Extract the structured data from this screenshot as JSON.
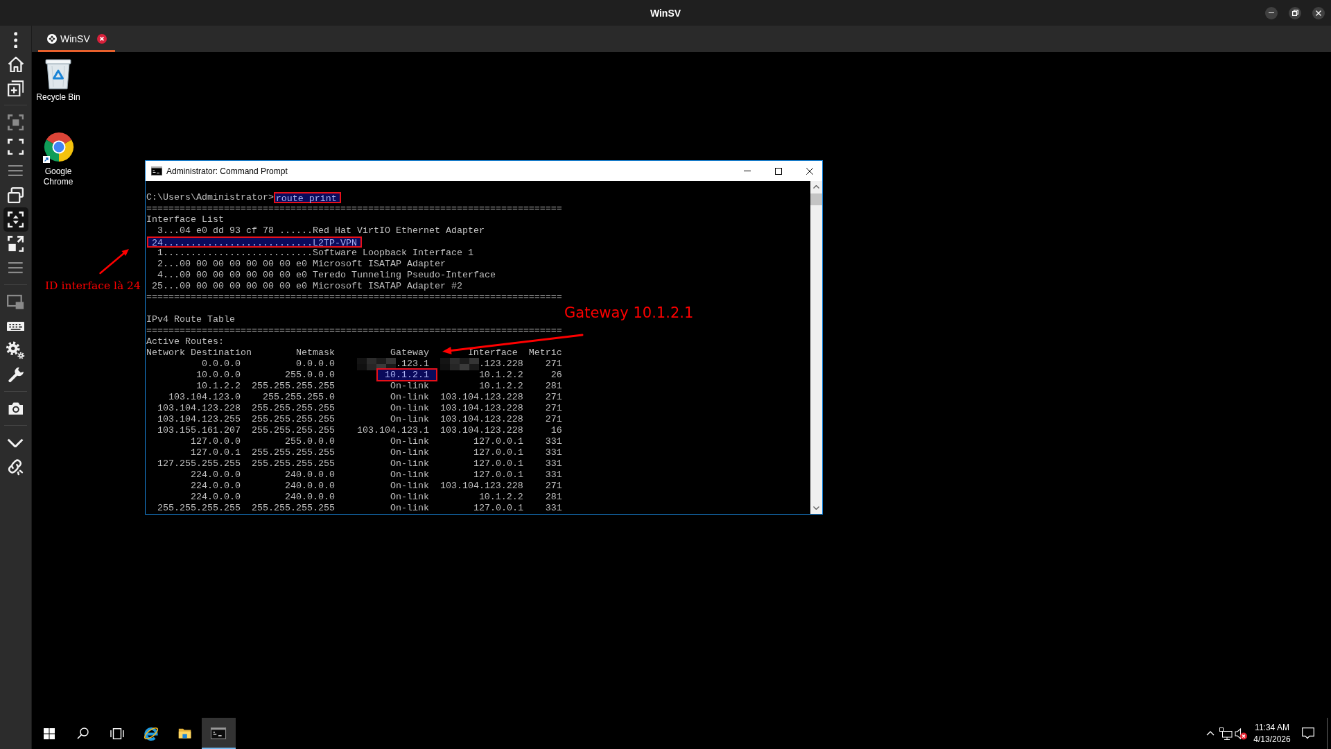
{
  "app": {
    "title": "WinSV"
  },
  "sidebar": {
    "groups": [
      {
        "items": [
          {
            "kind": "more",
            "disabled": false,
            "selected": false
          },
          {
            "kind": "home",
            "disabled": false,
            "selected": false
          },
          {
            "kind": "new_window",
            "disabled": false,
            "selected": false
          }
        ]
      },
      {
        "items": [
          {
            "kind": "focus",
            "disabled": true,
            "selected": false
          },
          {
            "kind": "fullscreen",
            "disabled": false,
            "selected": false
          },
          {
            "kind": "handle",
            "disabled": true,
            "selected": false
          },
          {
            "kind": "windows",
            "disabled": false,
            "selected": false
          },
          {
            "kind": "fit",
            "disabled": false,
            "selected": true
          },
          {
            "kind": "resize",
            "disabled": false,
            "selected": false
          },
          {
            "kind": "handle",
            "disabled": true,
            "selected": false
          }
        ]
      },
      {
        "items": [
          {
            "kind": "display",
            "disabled": true,
            "selected": false
          },
          {
            "kind": "keyboard",
            "disabled": false,
            "selected": false
          },
          {
            "kind": "settings",
            "disabled": false,
            "selected": false
          },
          {
            "kind": "tools",
            "disabled": false,
            "selected": false
          }
        ]
      },
      {
        "items": [
          {
            "kind": "screenshot",
            "disabled": false,
            "selected": false
          }
        ]
      },
      {
        "items": [
          {
            "kind": "collapse",
            "disabled": false,
            "selected": false
          },
          {
            "kind": "link",
            "disabled": false,
            "selected": false
          }
        ]
      }
    ]
  },
  "tabs": [
    {
      "label": "WinSV",
      "selected": true
    }
  ],
  "desktop": {
    "shortcuts": [
      {
        "kind": "recycle_bin",
        "label": "Recycle Bin"
      },
      {
        "kind": "browser",
        "label": "Google Chrome"
      }
    ]
  },
  "console_window": {
    "title": "Administrator: Command Prompt",
    "lines": [
      {
        "kind": "prompt",
        "prompt": "C:\\Users\\Administrator>",
        "command": "route print",
        "highlighted": true
      },
      {
        "kind": "output",
        "text": "===========================================================================",
        "highlighted": false
      },
      {
        "kind": "output",
        "text": "Interface List",
        "highlighted": false
      },
      {
        "kind": "interface",
        "text": "3...04 e0 dd 93 cf 78 ......Red Hat VirtIO Ethernet Adapter",
        "highlighted": false
      },
      {
        "kind": "interface",
        "text": "24...........................L2TP-VPN",
        "highlighted": true
      },
      {
        "kind": "interface",
        "text": "1...........................Software Loopback Interface 1",
        "highlighted": false
      },
      {
        "kind": "interface",
        "text": "2...00 00 00 00 00 00 00 e0 Microsoft ISATAP Adapter",
        "highlighted": false
      },
      {
        "kind": "interface",
        "text": "4...00 00 00 00 00 00 00 e0 Teredo Tunneling Pseudo-Interface",
        "highlighted": false
      },
      {
        "kind": "interface",
        "text": "25...00 00 00 00 00 00 00 e0 Microsoft ISATAP Adapter #2",
        "highlighted": false
      },
      {
        "kind": "output",
        "text": "===========================================================================",
        "highlighted": false
      },
      {
        "kind": "blank"
      },
      {
        "kind": "output",
        "text": "IPv4 Route Table",
        "highlighted": false
      },
      {
        "kind": "output",
        "text": "===========================================================================",
        "highlighted": false
      },
      {
        "kind": "output",
        "text": "Active Routes:",
        "highlighted": false
      },
      {
        "kind": "route_header",
        "columns": [
          "Network Destination",
          "Netmask",
          "Gateway",
          "Interface",
          "Metric"
        ]
      },
      {
        "kind": "route",
        "cells": [
          "0.0.0.0",
          "0.0.0.0",
          ".123.1",
          ".123.228",
          "271"
        ],
        "gateway_redacted": true,
        "interface_redacted": true,
        "gateway_highlighted": false
      },
      {
        "kind": "route",
        "cells": [
          "10.0.0.0",
          "255.0.0.0",
          "10.1.2.1",
          "10.1.2.2",
          "26"
        ],
        "gateway_redacted": false,
        "interface_redacted": false,
        "gateway_highlighted": true
      },
      {
        "kind": "route",
        "cells": [
          "10.1.2.2",
          "255.255.255.255",
          "On-link",
          "10.1.2.2",
          "281"
        ],
        "gateway_redacted": false,
        "interface_redacted": false,
        "gateway_highlighted": false
      },
      {
        "kind": "route",
        "cells": [
          "103.104.123.0",
          "255.255.255.0",
          "On-link",
          "103.104.123.228",
          "271"
        ],
        "gateway_redacted": false,
        "interface_redacted": false,
        "gateway_highlighted": false
      },
      {
        "kind": "route",
        "cells": [
          "103.104.123.228",
          "255.255.255.255",
          "On-link",
          "103.104.123.228",
          "271"
        ],
        "gateway_redacted": false,
        "interface_redacted": false,
        "gateway_highlighted": false
      },
      {
        "kind": "route",
        "cells": [
          "103.104.123.255",
          "255.255.255.255",
          "On-link",
          "103.104.123.228",
          "271"
        ],
        "gateway_redacted": false,
        "interface_redacted": false,
        "gateway_highlighted": false
      },
      {
        "kind": "route",
        "cells": [
          "103.155.161.207",
          "255.255.255.255",
          "103.104.123.1",
          "103.104.123.228",
          "16"
        ],
        "gateway_redacted": false,
        "interface_redacted": false,
        "gateway_highlighted": false
      },
      {
        "kind": "route",
        "cells": [
          "127.0.0.0",
          "255.0.0.0",
          "On-link",
          "127.0.0.1",
          "331"
        ],
        "gateway_redacted": false,
        "interface_redacted": false,
        "gateway_highlighted": false
      },
      {
        "kind": "route",
        "cells": [
          "127.0.0.1",
          "255.255.255.255",
          "On-link",
          "127.0.0.1",
          "331"
        ],
        "gateway_redacted": false,
        "interface_redacted": false,
        "gateway_highlighted": false
      },
      {
        "kind": "route",
        "cells": [
          "127.255.255.255",
          "255.255.255.255",
          "On-link",
          "127.0.0.1",
          "331"
        ],
        "gateway_redacted": false,
        "interface_redacted": false,
        "gateway_highlighted": false
      },
      {
        "kind": "route",
        "cells": [
          "224.0.0.0",
          "240.0.0.0",
          "On-link",
          "127.0.0.1",
          "331"
        ],
        "gateway_redacted": false,
        "interface_redacted": false,
        "gateway_highlighted": false
      },
      {
        "kind": "route",
        "cells": [
          "224.0.0.0",
          "240.0.0.0",
          "On-link",
          "103.104.123.228",
          "271"
        ],
        "gateway_redacted": false,
        "interface_redacted": false,
        "gateway_highlighted": false
      },
      {
        "kind": "route",
        "cells": [
          "224.0.0.0",
          "240.0.0.0",
          "On-link",
          "10.1.2.2",
          "281"
        ],
        "gateway_redacted": false,
        "interface_redacted": false,
        "gateway_highlighted": false
      },
      {
        "kind": "route",
        "cells": [
          "255.255.255.255",
          "255.255.255.255",
          "On-link",
          "127.0.0.1",
          "331"
        ],
        "gateway_redacted": false,
        "interface_redacted": false,
        "gateway_highlighted": false
      }
    ]
  },
  "annotations": {
    "interface_note": {
      "text": "ID interface là 24"
    },
    "gateway_note": {
      "text": "Gateway 10.1.2.1"
    }
  },
  "taskbar": {
    "apps": [
      {
        "kind": "start",
        "active": false
      },
      {
        "kind": "search",
        "active": false
      },
      {
        "kind": "task_view",
        "active": false
      },
      {
        "kind": "browser",
        "active": false
      },
      {
        "kind": "file_explorer",
        "active": false
      },
      {
        "kind": "console",
        "active": true
      }
    ],
    "tray": {
      "volume_muted": true,
      "time": "11:34 AM",
      "date": "4/13/2026"
    }
  }
}
